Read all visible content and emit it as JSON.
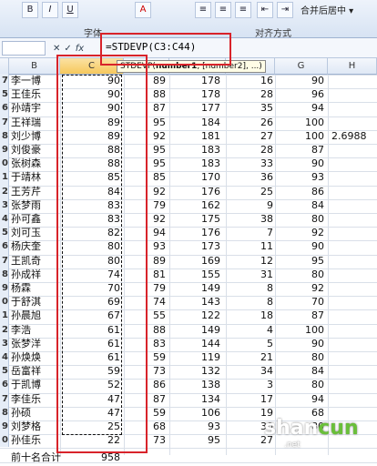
{
  "ribbon": {
    "font_buttons": [
      "B",
      "I",
      "U",
      "A"
    ],
    "align_buttons": [
      "≡",
      "≡",
      "≡",
      "⇤",
      "⇥"
    ],
    "merge_label": "合并后居中 ▾",
    "group_font": "字体",
    "group_align": "对齐方式"
  },
  "formula_bar": {
    "namebox": "",
    "cancel": "✕",
    "enter": "✓",
    "fx": "fx",
    "formula": "=STDEVP(C3:C44)"
  },
  "tooltip": {
    "fn": "STDEVP(",
    "arg1": "number1",
    "rest": ", [number2], ...)"
  },
  "columns": [
    "B",
    "C",
    "D",
    "E",
    "F",
    "G",
    "H"
  ],
  "rows": [
    {
      "num": "7",
      "name": "李一博",
      "c": "90",
      "d": "89",
      "e": "178",
      "f": "16",
      "g": "90",
      "h": ""
    },
    {
      "num": "5",
      "name": "王佳乐",
      "c": "90",
      "d": "88",
      "e": "178",
      "f": "28",
      "g": "96",
      "h": ""
    },
    {
      "num": "6",
      "name": "孙靖宇",
      "c": "90",
      "d": "87",
      "e": "177",
      "f": "35",
      "g": "94",
      "h": ""
    },
    {
      "num": "7",
      "name": "王祥瑞",
      "c": "89",
      "d": "95",
      "e": "184",
      "f": "26",
      "g": "100",
      "h": ""
    },
    {
      "num": "8",
      "name": "刘少博",
      "c": "89",
      "d": "92",
      "e": "181",
      "f": "27",
      "g": "100",
      "h": "2.6988"
    },
    {
      "num": "9",
      "name": "刘俊豪",
      "c": "88",
      "d": "95",
      "e": "183",
      "f": "28",
      "g": "87",
      "h": ""
    },
    {
      "num": "0",
      "name": "张树森",
      "c": "88",
      "d": "95",
      "e": "183",
      "f": "33",
      "g": "90",
      "h": ""
    },
    {
      "num": "1",
      "name": "于靖林",
      "c": "85",
      "d": "85",
      "e": "170",
      "f": "36",
      "g": "93",
      "h": ""
    },
    {
      "num": "2",
      "name": "王芳芹",
      "c": "84",
      "d": "92",
      "e": "176",
      "f": "25",
      "g": "86",
      "h": ""
    },
    {
      "num": "3",
      "name": "张梦雨",
      "c": "83",
      "d": "79",
      "e": "162",
      "f": "9",
      "g": "84",
      "h": ""
    },
    {
      "num": "4",
      "name": "孙可鑫",
      "c": "83",
      "d": "92",
      "e": "175",
      "f": "38",
      "g": "80",
      "h": ""
    },
    {
      "num": "5",
      "name": "刘可玉",
      "c": "82",
      "d": "94",
      "e": "176",
      "f": "7",
      "g": "92",
      "h": ""
    },
    {
      "num": "6",
      "name": "杨庆奎",
      "c": "80",
      "d": "93",
      "e": "173",
      "f": "11",
      "g": "90",
      "h": ""
    },
    {
      "num": "7",
      "name": "王凯奇",
      "c": "80",
      "d": "89",
      "e": "169",
      "f": "12",
      "g": "95",
      "h": ""
    },
    {
      "num": "8",
      "name": "孙成祥",
      "c": "74",
      "d": "81",
      "e": "155",
      "f": "31",
      "g": "80",
      "h": ""
    },
    {
      "num": "9",
      "name": "杨霖",
      "c": "70",
      "d": "79",
      "e": "149",
      "f": "8",
      "g": "92",
      "h": ""
    },
    {
      "num": "0",
      "name": "于舒淇",
      "c": "69",
      "d": "74",
      "e": "143",
      "f": "8",
      "g": "70",
      "h": ""
    },
    {
      "num": "1",
      "name": "孙晨旭",
      "c": "67",
      "d": "55",
      "e": "122",
      "f": "18",
      "g": "87",
      "h": ""
    },
    {
      "num": "2",
      "name": "李浩",
      "c": "61",
      "d": "88",
      "e": "149",
      "f": "4",
      "g": "100",
      "h": ""
    },
    {
      "num": "3",
      "name": "张梦洋",
      "c": "61",
      "d": "83",
      "e": "144",
      "f": "5",
      "g": "90",
      "h": ""
    },
    {
      "num": "4",
      "name": "孙焕焕",
      "c": "61",
      "d": "59",
      "e": "119",
      "f": "21",
      "g": "80",
      "h": ""
    },
    {
      "num": "5",
      "name": "岳富祥",
      "c": "59",
      "d": "73",
      "e": "132",
      "f": "34",
      "g": "84",
      "h": ""
    },
    {
      "num": "6",
      "name": "于凯博",
      "c": "52",
      "d": "86",
      "e": "138",
      "f": "3",
      "g": "80",
      "h": ""
    },
    {
      "num": "7",
      "name": "李佳乐",
      "c": "47",
      "d": "87",
      "e": "134",
      "f": "17",
      "g": "94",
      "h": ""
    },
    {
      "num": "8",
      "name": "孙硕",
      "c": "47",
      "d": "59",
      "e": "106",
      "f": "19",
      "g": "68",
      "h": ""
    },
    {
      "num": "9",
      "name": "刘梦格",
      "c": "25",
      "d": "68",
      "e": "93",
      "f": "30",
      "g": "80",
      "h": ""
    },
    {
      "num": "0",
      "name": "孙佳乐",
      "c": "22",
      "d": "73",
      "e": "95",
      "f": "27",
      "g": "",
      "h": ""
    }
  ],
  "total_row": {
    "label": "前十名合计",
    "value": "958"
  },
  "watermark": {
    "text_a": "shan",
    "text_b": "cun",
    "text_c": ".net"
  }
}
